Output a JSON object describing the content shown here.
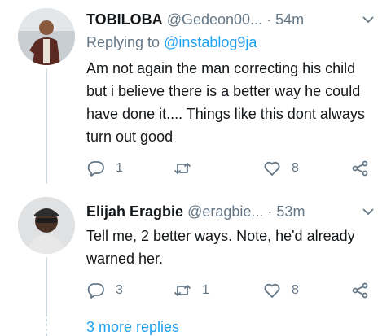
{
  "tweets": [
    {
      "name": "TOBILOBA",
      "handle": "@Gedeon00...",
      "separator": "·",
      "time": "54m",
      "replying_label": "Replying to",
      "replying_to": "@instablog9ja",
      "text": "Am not again the man correcting his child but i believe there is a better way he could have done it.... Things like this dont always turn out good",
      "replies": "1",
      "retweets": "",
      "likes": "8"
    },
    {
      "name": "Elijah Eragbie",
      "handle": "@eragbie...",
      "separator": "·",
      "time": "53m",
      "text": "Tell me, 2 better ways. Note, he'd already warned her.",
      "replies": "3",
      "retweets": "1",
      "likes": "8"
    }
  ],
  "more_replies": "3 more replies",
  "colors": {
    "link": "#1da1f2",
    "muted": "#657786",
    "text": "#14171a",
    "thread_line": "#ccd6dd"
  }
}
